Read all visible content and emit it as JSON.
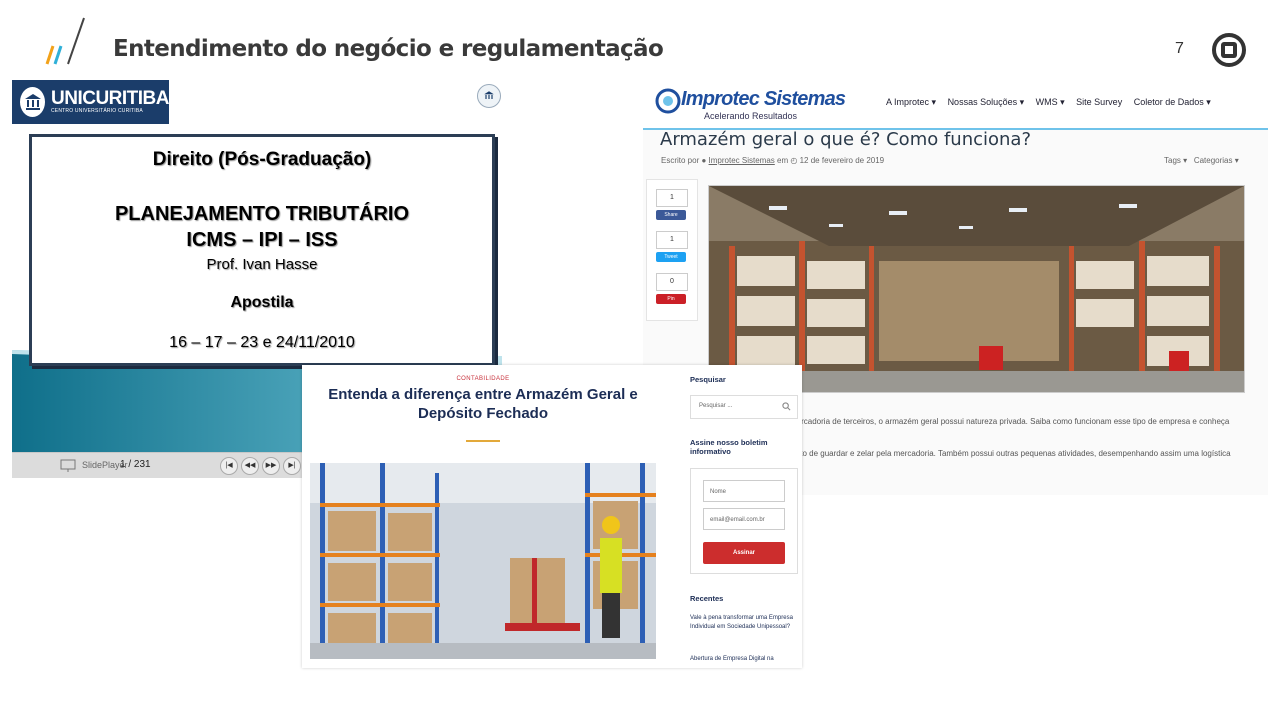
{
  "header": {
    "title": "Entendimento do negócio e regulamentação",
    "page_number": "7",
    "icons": [
      "slashes-logo",
      "brand-circle-icon"
    ]
  },
  "slideplayer": {
    "logo_name": "UNICURITIBA",
    "logo_sub": "CENTRO UNIVERSITÁRIO CURITIBA",
    "slide_lines": [
      "Direito (Pós-Graduação)",
      "PLANEJAMENTO TRIBUTÁRIO",
      "ICMS – IPI – ISS",
      "Prof. Ivan Hasse",
      "Apostila",
      "16 – 17 – 23 e 24/11/2010"
    ],
    "brand": "SlidePlayer",
    "page_counter": "1 / 231"
  },
  "improtec": {
    "logo_name": "Improtec Sistemas",
    "logo_tagline": "Acelerando Resultados",
    "nav": [
      "A Improtec ▾",
      "Nossas Soluções ▾",
      "WMS ▾",
      "Site Survey",
      "Coletor de Dados ▾"
    ],
    "article_title": "Armazém geral o que é? Como funciona?",
    "meta_prefix": "Escrito por",
    "meta_author": "Improtec Sistemas",
    "meta_em": "em",
    "meta_date": "12 de fevereiro de 2019",
    "tags": "Tags ▾",
    "categories": "Categorias ▾",
    "share": [
      {
        "count": "1",
        "label": "Share",
        "color": "#3b5998"
      },
      {
        "count": "1",
        "label": "Tweet",
        "color": "#1da1f2"
      },
      {
        "count": "0",
        "label": "Pin",
        "color": "#cb2027"
      }
    ],
    "body_lines": [
      "mercadoria de terceiros, o armazém geral possui natureza privada. Saiba como funcionam esse tipo de empresa e conheça",
      "ituito de guardar e zelar pela mercadoria. Também possui outras pequenas atividades, desempenhando assim uma logística"
    ]
  },
  "contabilidade": {
    "category": "CONTABILIDADE",
    "title_line1": "Entenda a diferença entre Armazém Geral e",
    "title_line2": "Depósito Fechado",
    "sidebar": {
      "search_title": "Pesquisar",
      "search_placeholder": "Pesquisar ...",
      "newsletter_title": "Assine nosso boletim informativo",
      "name_placeholder": "Nome",
      "email_placeholder": "email@email.com.br",
      "subscribe_label": "Assinar",
      "recent_title": "Recentes",
      "recent_1": "Vale à pena transformar uma Empresa Individual em Sociedade Unipessoal?",
      "recent_2": "Abertura de Empresa Digital na"
    }
  }
}
